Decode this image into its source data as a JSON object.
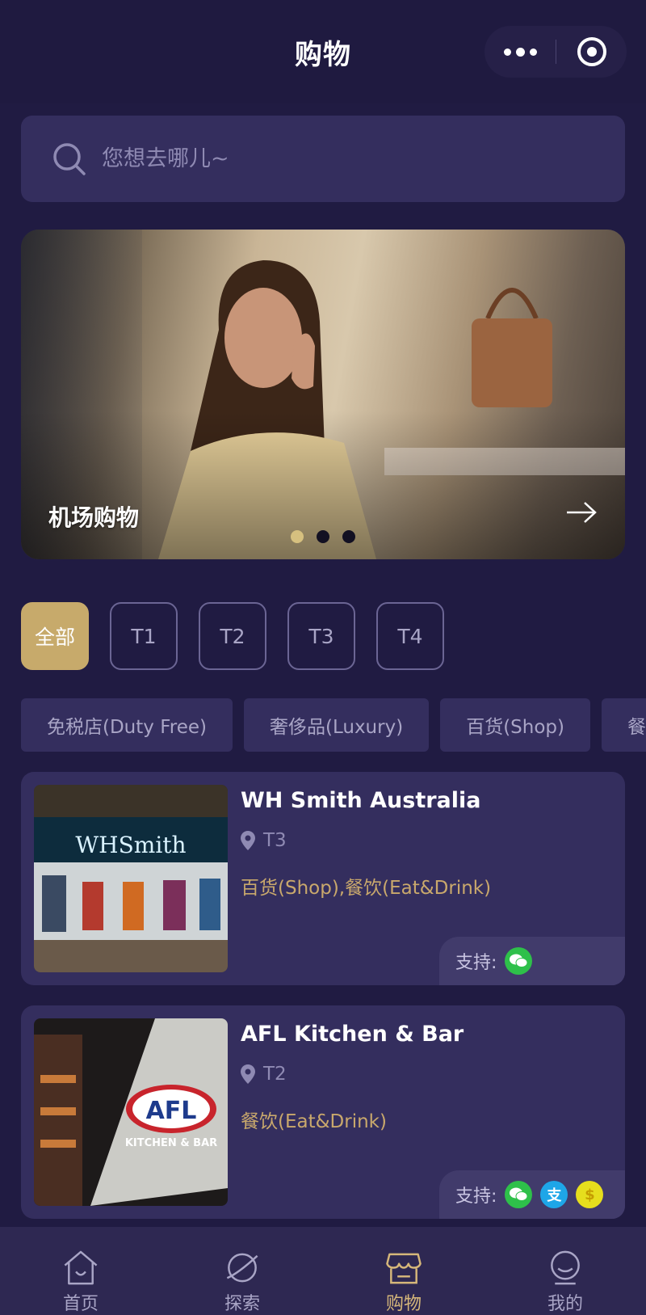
{
  "header": {
    "title": "购物",
    "more_icon": "more-dots-icon",
    "close_icon": "target-circle-icon"
  },
  "search": {
    "placeholder": "您想去哪儿~",
    "icon": "search-icon"
  },
  "banner": {
    "label": "机场购物",
    "arrow_icon": "arrow-right-icon",
    "slide_count": 3,
    "active_slide": 1
  },
  "terminal_tabs": [
    {
      "label": "全部",
      "active": true
    },
    {
      "label": "T1",
      "active": false
    },
    {
      "label": "T2",
      "active": false
    },
    {
      "label": "T3",
      "active": false
    },
    {
      "label": "T4",
      "active": false
    }
  ],
  "categories": [
    {
      "label": "免税店(Duty Free)"
    },
    {
      "label": "奢侈品(Luxury)"
    },
    {
      "label": "百货(Shop)"
    },
    {
      "label": "餐"
    }
  ],
  "shops": [
    {
      "name": "WH Smith Australia",
      "location": "T3",
      "categories": "百货(Shop),餐饮(Eat&Drink)",
      "payment_label": "支持:",
      "payment_methods": [
        "wechat-pay-icon"
      ],
      "image_text": "WHSmith"
    },
    {
      "name": "AFL Kitchen & Bar",
      "location": "T2",
      "categories": "餐饮(Eat&Drink)",
      "payment_label": "支持:",
      "payment_methods": [
        "wechat-pay-icon",
        "alipay-icon",
        "yuan-icon"
      ],
      "image_text": "AFL",
      "image_subtext": "KITCHEN & BAR",
      "alipay_glyph": "支",
      "yuan_glyph": "$"
    }
  ],
  "tab_bar": [
    {
      "label": "首页",
      "icon": "home-icon",
      "active": false
    },
    {
      "label": "探索",
      "icon": "planet-icon",
      "active": false
    },
    {
      "label": "购物",
      "icon": "store-icon",
      "active": true
    },
    {
      "label": "我的",
      "icon": "profile-icon",
      "active": false
    }
  ],
  "colors": {
    "background": "#201b42",
    "card": "#342e5e",
    "accent_gold": "#c7aa6b",
    "category_text": "#c9a86c"
  }
}
